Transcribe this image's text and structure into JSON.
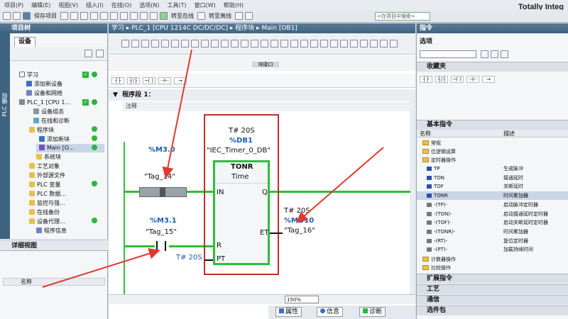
{
  "menubar": [
    "项目(P)",
    "编辑(E)",
    "视图(V)",
    "插入(I)",
    "在线(O)",
    "选项(N)",
    "工具(T)",
    "窗口(W)",
    "帮助(H)"
  ],
  "brand": "Totally Integ",
  "toolbar": {
    "save_project": "保存项目",
    "go_online": "转至在线",
    "go_offline": "转至离线",
    "search_placeholder": "<在项目中搜索>"
  },
  "project_tree": {
    "title": "项目树",
    "side_label": "PLC 编程",
    "devices_tab": "设备",
    "items": [
      {
        "label": "学习"
      },
      {
        "label": "添加新设备"
      },
      {
        "label": "设备和网络"
      },
      {
        "label": "PLC_1 [CPU 1..."
      },
      {
        "label": "设备组态"
      },
      {
        "label": "在线和诊断"
      },
      {
        "label": "程序块"
      },
      {
        "label": "添加新块"
      },
      {
        "label": "Main [O..."
      },
      {
        "label": "系统块"
      },
      {
        "label": "工艺对象"
      },
      {
        "label": "外部源文件"
      },
      {
        "label": "PLC 变量"
      },
      {
        "label": "PLC 数据..."
      },
      {
        "label": "监控与强..."
      },
      {
        "label": "在线备份"
      },
      {
        "label": "设备代理..."
      },
      {
        "label": "程序信息"
      }
    ]
  },
  "detail_view": {
    "title": "详细视图",
    "column_name": "名称"
  },
  "editor": {
    "breadcrumb": "学习  ▸  PLC_1 [CPU 1214C DC/DC/DC]  ▸  程序块  ▸  Main [OB1]",
    "interface_label": "块接口",
    "network_title": "程序段 1：",
    "comment": "注释",
    "zoom": "150%",
    "bottom_tabs": [
      "属性",
      "信息",
      "诊断"
    ]
  },
  "ladder": {
    "contact1": {
      "address": "%M3.0",
      "tag": "\"Tag_14\""
    },
    "contact2": {
      "address": "%M3.1",
      "tag": "\"Tag_15\""
    },
    "block": {
      "preset": "T# 20S",
      "db": "%DB1",
      "instance": "\"IEC_Timer_0_DB\"",
      "type": "TONR",
      "subtype": "Time",
      "pins": {
        "in": "IN",
        "q": "Q",
        "r": "R",
        "pt": "PT",
        "et": "ET"
      }
    },
    "pt_value": "T# 20S",
    "output": {
      "preset": "T# 20S",
      "address": "%MD10",
      "tag": "\"Tag_16\""
    }
  },
  "instructions": {
    "title": "指令",
    "options": "选项",
    "favorites": "收藏夹",
    "basic": "基本指令",
    "col_name": "名称",
    "col_desc": "描述",
    "folders": [
      "常规",
      "位逻辑运算",
      "定时器操作"
    ],
    "timers": [
      {
        "name": "TP",
        "desc": "生成脉冲"
      },
      {
        "name": "TON",
        "desc": "接通延时"
      },
      {
        "name": "TOF",
        "desc": "关断延时"
      },
      {
        "name": "TONR",
        "desc": "时间累加器"
      },
      {
        "name": "-(TP)-",
        "desc": "启动脉冲定时器"
      },
      {
        "name": "-(TON)-",
        "desc": "启动接通延时定时器"
      },
      {
        "name": "-(TOF)-",
        "desc": "启动关断延时定时器"
      },
      {
        "name": "-(TONR)-",
        "desc": "时间累加器"
      },
      {
        "name": "-(RT)-",
        "desc": "复位定时器"
      },
      {
        "name": "-(PT)-",
        "desc": "加载持续时间"
      }
    ],
    "more_folders": [
      "计数器操作",
      "比较操作"
    ],
    "sections": [
      "扩展指令",
      "工艺",
      "通信",
      "选件包"
    ]
  },
  "colors": {
    "rung": "#2fbf3a",
    "annotation_red": "#e03a30",
    "title_bar": "#3e6380",
    "accent_blue": "#1e5db3"
  }
}
